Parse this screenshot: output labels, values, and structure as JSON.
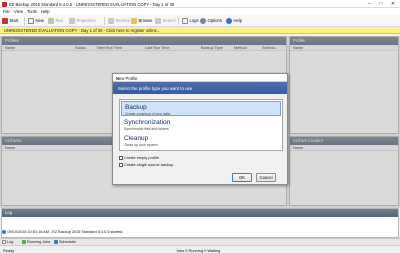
{
  "window": {
    "title": "EZ Backup 2015 Standard 8.4.0.5 - UNREGISTERED EVALUATION COPY - Day 1 of 30",
    "minimize": "–",
    "maximize": "□",
    "close": "✕"
  },
  "menu": [
    "File",
    "View",
    "Tools",
    "Help"
  ],
  "toolbar": {
    "start": "Start",
    "new": "New",
    "run": "Run",
    "properties": "Properties",
    "restore": "Restore",
    "browse": "Browse",
    "search": "Search",
    "logs": "Logs",
    "options": "Options",
    "help": "Help"
  },
  "banner": "UNREGISTERED EVALUATION COPY - Day 1 of 30 - Click here to register online...",
  "profiles": {
    "header": "Profiles",
    "columns": [
      "Name",
      "Status",
      "Next Run Time",
      "Last Run Time",
      "Backup Type",
      "Method",
      "Schedu..."
    ]
  },
  "right_profile": {
    "header": "Profile",
    "column": "Name"
  },
  "archives": {
    "header": "Archives",
    "column": "Name"
  },
  "archive_content": {
    "header": "Archive Content",
    "column": "Name"
  },
  "log": {
    "header": "Log",
    "entry": "09/10/2016 10:51:16 AM - EZ Backup 2015 Standard 8.4.0.5 started."
  },
  "bottom_tabs": [
    "Log",
    "Running Jobs",
    "Scheduler"
  ],
  "status": {
    "left": "Ready",
    "jobs": "Jobs 0 Running 0 Waiting"
  },
  "dialog": {
    "title": "New Profile",
    "close": "✕",
    "instruction": "Select the profile type you want to use",
    "types": [
      {
        "name": "Backup",
        "desc": "Create a backup of your data"
      },
      {
        "name": "Synchronization",
        "desc": "Synchronize files and folders"
      },
      {
        "name": "Cleanup",
        "desc": "Clean up your system"
      }
    ],
    "empty_profile": "Create empty profile",
    "single_source": "Create single source backup",
    "ok": "OK",
    "cancel": "Cancel"
  },
  "colors": {
    "panel_header": "#5f6f84",
    "banner": "#fff27a",
    "dialog_header": "#3f619f",
    "selected": "#cfe3fb"
  }
}
